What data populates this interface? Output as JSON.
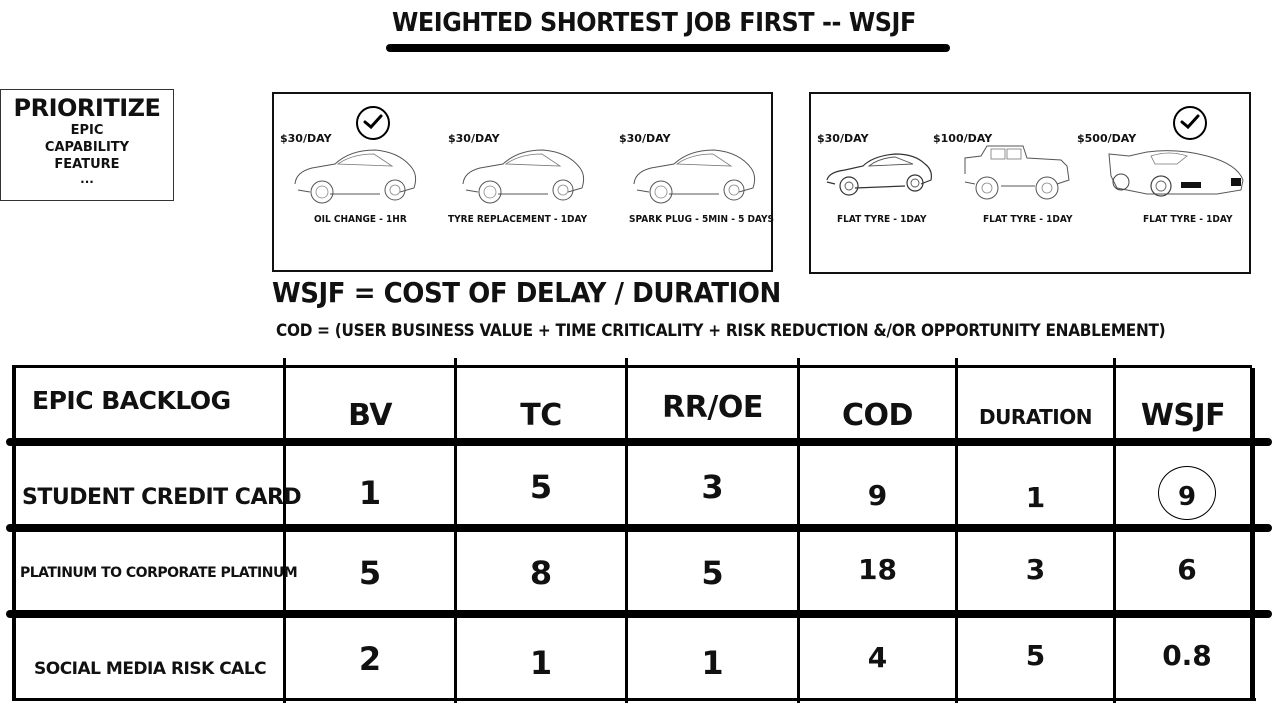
{
  "title": "WEIGHTED SHORTEST JOB FIRST  -- WSJF",
  "prioritize": {
    "heading": "PRIORITIZE",
    "items": [
      "EPIC",
      "CAPABILITY",
      "FEATURE",
      "..."
    ]
  },
  "scenarios": [
    {
      "cars": [
        {
          "price": "$30/DAY",
          "task": "OIL CHANGE - 1HR",
          "selected": true,
          "icon": "sedan-icon"
        },
        {
          "price": "$30/DAY",
          "task": "TYRE REPLACEMENT - 1DAY",
          "selected": false,
          "icon": "sedan-icon"
        },
        {
          "price": "$30/DAY",
          "task": "SPARK PLUG - 5MIN - 5 DAYS",
          "selected": false,
          "icon": "sedan-icon"
        }
      ]
    },
    {
      "cars": [
        {
          "price": "$30/DAY",
          "task": "FLAT TYRE - 1DAY",
          "selected": false,
          "icon": "sedan-icon"
        },
        {
          "price": "$100/DAY",
          "task": "FLAT TYRE - 1DAY",
          "selected": false,
          "icon": "jeep-icon"
        },
        {
          "price": "$500/DAY",
          "task": "FLAT TYRE - 1DAY",
          "selected": true,
          "icon": "sports-car-icon"
        }
      ]
    }
  ],
  "formula": "WSJF = COST OF DELAY / DURATION",
  "cod_formula": "COD = (USER BUSINESS VALUE + TIME CRITICALITY + RISK REDUCTION &/OR OPPORTUNITY ENABLEMENT)",
  "table": {
    "headers": [
      "EPIC BACKLOG",
      "BV",
      "TC",
      "RR/OE",
      "COD",
      "DURATION",
      "WSJF"
    ],
    "rows": [
      {
        "epic": "STUDENT CREDIT CARD",
        "bv": "1",
        "tc": "5",
        "rr_oe": "3",
        "cod": "9",
        "duration": "1",
        "wsjf": "9",
        "highlighted": true
      },
      {
        "epic": "PLATINUM TO CORPORATE PLATINUM",
        "bv": "5",
        "tc": "8",
        "rr_oe": "5",
        "cod": "18",
        "duration": "3",
        "wsjf": "6",
        "highlighted": false
      },
      {
        "epic": "SOCIAL MEDIA RISK CALC",
        "bv": "2",
        "tc": "1",
        "rr_oe": "1",
        "cod": "4",
        "duration": "5",
        "wsjf": "0.8",
        "highlighted": false
      }
    ]
  }
}
